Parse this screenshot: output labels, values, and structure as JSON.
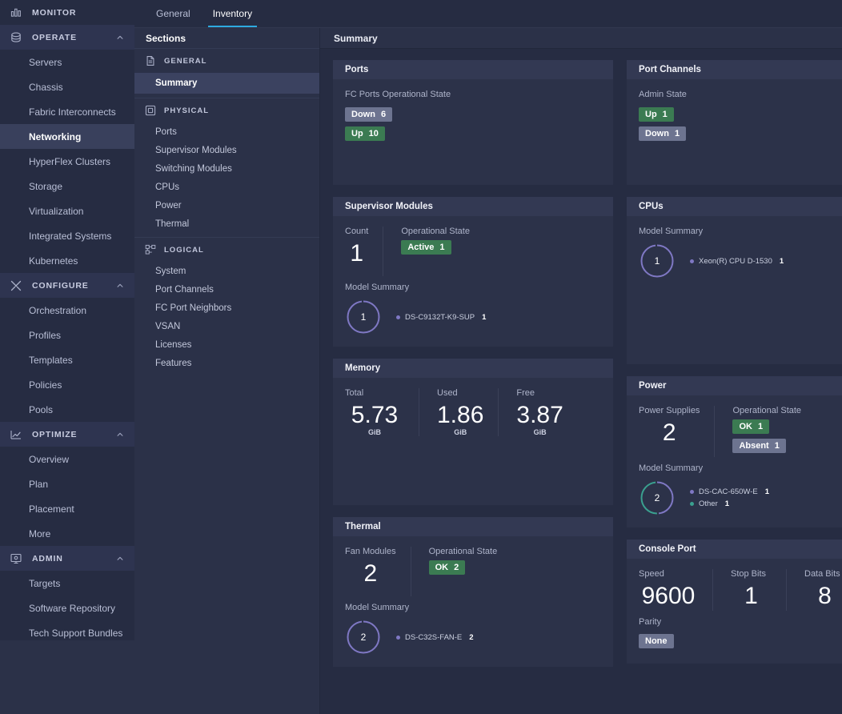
{
  "colors": {
    "accent": "#2eaae0",
    "green": "#3b7b52",
    "grey": "#6d7490",
    "purple": "#7f78c4",
    "teal": "#3aa08f"
  },
  "leftnav": {
    "groups": [
      {
        "label": "MONITOR",
        "icon": "bar-chart-icon",
        "collapsible": false,
        "items": []
      },
      {
        "label": "OPERATE",
        "icon": "layers-icon",
        "collapsible": true,
        "items": [
          {
            "label": "Servers",
            "active": false
          },
          {
            "label": "Chassis",
            "active": false
          },
          {
            "label": "Fabric Interconnects",
            "active": false
          },
          {
            "label": "Networking",
            "active": true
          },
          {
            "label": "HyperFlex Clusters",
            "active": false
          },
          {
            "label": "Storage",
            "active": false
          },
          {
            "label": "Virtualization",
            "active": false
          },
          {
            "label": "Integrated Systems",
            "active": false
          },
          {
            "label": "Kubernetes",
            "active": false
          }
        ]
      },
      {
        "label": "CONFIGURE",
        "icon": "tools-icon",
        "collapsible": true,
        "items": [
          {
            "label": "Orchestration",
            "active": false
          },
          {
            "label": "Profiles",
            "active": false
          },
          {
            "label": "Templates",
            "active": false
          },
          {
            "label": "Policies",
            "active": false
          },
          {
            "label": "Pools",
            "active": false
          }
        ]
      },
      {
        "label": "OPTIMIZE",
        "icon": "trend-line-icon",
        "collapsible": true,
        "items": [
          {
            "label": "Overview",
            "active": false
          },
          {
            "label": "Plan",
            "active": false
          },
          {
            "label": "Placement",
            "active": false
          },
          {
            "label": "More",
            "active": false
          }
        ]
      },
      {
        "label": "ADMIN",
        "icon": "admin-monitor-icon",
        "collapsible": true,
        "items": [
          {
            "label": "Targets",
            "active": false
          },
          {
            "label": "Software Repository",
            "active": false
          },
          {
            "label": "Tech Support Bundles",
            "active": false
          }
        ]
      }
    ]
  },
  "tabs": [
    {
      "label": "General",
      "active": false
    },
    {
      "label": "Inventory",
      "active": true
    }
  ],
  "sections": {
    "title": "Sections",
    "groups": [
      {
        "label": "GENERAL",
        "icon": "document-icon",
        "items": [
          {
            "label": "Summary",
            "active": true
          }
        ]
      },
      {
        "label": "PHYSICAL",
        "icon": "square-outline-icon",
        "items": [
          {
            "label": "Ports",
            "active": false
          },
          {
            "label": "Supervisor Modules",
            "active": false
          },
          {
            "label": "Switching Modules",
            "active": false
          },
          {
            "label": "CPUs",
            "active": false
          },
          {
            "label": "Power",
            "active": false
          },
          {
            "label": "Thermal",
            "active": false
          }
        ]
      },
      {
        "label": "LOGICAL",
        "icon": "blocks-icon",
        "items": [
          {
            "label": "System",
            "active": false
          },
          {
            "label": "Port Channels",
            "active": false
          },
          {
            "label": "FC Port Neighbors",
            "active": false
          },
          {
            "label": "VSAN",
            "active": false
          },
          {
            "label": "Licenses",
            "active": false
          },
          {
            "label": "Features",
            "active": false
          }
        ]
      }
    ]
  },
  "content": {
    "header": "Summary",
    "ports": {
      "title": "Ports",
      "state_label": "FC Ports Operational State",
      "badges": [
        {
          "label": "Down",
          "count": "6",
          "style": "grey"
        },
        {
          "label": "Up",
          "count": "10",
          "style": "green"
        }
      ]
    },
    "port_channels": {
      "title": "Port Channels",
      "state_label": "Admin State",
      "badges": [
        {
          "label": "Up",
          "count": "1",
          "style": "green"
        },
        {
          "label": "Down",
          "count": "1",
          "style": "grey"
        }
      ]
    },
    "supervisor_modules": {
      "title": "Supervisor Modules",
      "count_label": "Count",
      "count_value": "1",
      "state_label": "Operational State",
      "badges": [
        {
          "label": "Active",
          "count": "1",
          "style": "green"
        }
      ],
      "model_summary_label": "Model Summary",
      "donut_total": "1",
      "models": [
        {
          "name": "DS-C9132T-K9-SUP",
          "count": "1",
          "color": "#7f78c4"
        }
      ]
    },
    "cpus": {
      "title": "CPUs",
      "model_summary_label": "Model Summary",
      "donut_total": "1",
      "models": [
        {
          "name": "Xeon(R) CPU D-1530",
          "count": "1",
          "color": "#7f78c4"
        }
      ]
    },
    "memory": {
      "title": "Memory",
      "stats": [
        {
          "label": "Total",
          "value": "5.73",
          "unit": "GiB"
        },
        {
          "label": "Used",
          "value": "1.86",
          "unit": "GiB"
        },
        {
          "label": "Free",
          "value": "3.87",
          "unit": "GiB"
        }
      ]
    },
    "power": {
      "title": "Power",
      "count_label": "Power Supplies",
      "count_value": "2",
      "state_label": "Operational State",
      "badges": [
        {
          "label": "OK",
          "count": "1",
          "style": "green"
        },
        {
          "label": "Absent",
          "count": "1",
          "style": "grey"
        }
      ],
      "model_summary_label": "Model Summary",
      "donut_total": "2",
      "models": [
        {
          "name": "DS-CAC-650W-E",
          "count": "1",
          "color": "#7f78c4"
        },
        {
          "name": "Other",
          "count": "1",
          "color": "#3aa08f"
        }
      ]
    },
    "thermal": {
      "title": "Thermal",
      "count_label": "Fan Modules",
      "count_value": "2",
      "state_label": "Operational State",
      "badges": [
        {
          "label": "OK",
          "count": "2",
          "style": "green"
        }
      ],
      "model_summary_label": "Model Summary",
      "donut_total": "2",
      "models": [
        {
          "name": "DS-C32S-FAN-E",
          "count": "2",
          "color": "#7f78c4"
        }
      ]
    },
    "console_port": {
      "title": "Console Port",
      "stats": [
        {
          "label": "Speed",
          "value": "9600"
        },
        {
          "label": "Stop Bits",
          "value": "1"
        },
        {
          "label": "Data Bits",
          "value": "8"
        }
      ],
      "parity_label": "Parity",
      "parity_badges": [
        {
          "label": "None",
          "style": "grey"
        }
      ]
    }
  }
}
